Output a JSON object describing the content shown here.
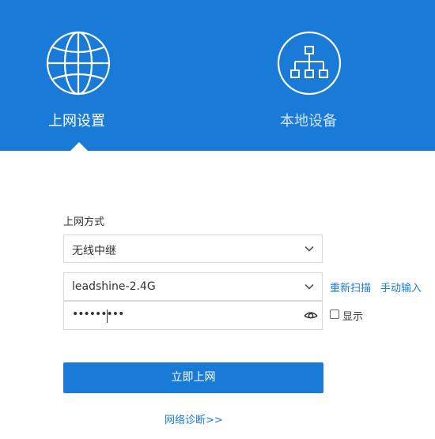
{
  "header": {
    "tabs": [
      {
        "label": "上网设置",
        "icon": "globe-icon",
        "active": true
      },
      {
        "label": "本地设备",
        "icon": "network-tree-icon",
        "active": false
      }
    ],
    "colors": {
      "brand": "#1a7ad8",
      "inactive_tab_text": "#cfe3f7"
    }
  },
  "form": {
    "mode_label": "上网方式",
    "mode_value": "无线中继",
    "ssid_value": "leadshine-2.4G",
    "password_mask": "•••••••••",
    "rescan_label": "重新扫描",
    "manual_label": "手动输入",
    "show_label": "显示",
    "show_checked": false,
    "submit_label": "立即上网",
    "diagnose_label": "网络诊断>>"
  }
}
